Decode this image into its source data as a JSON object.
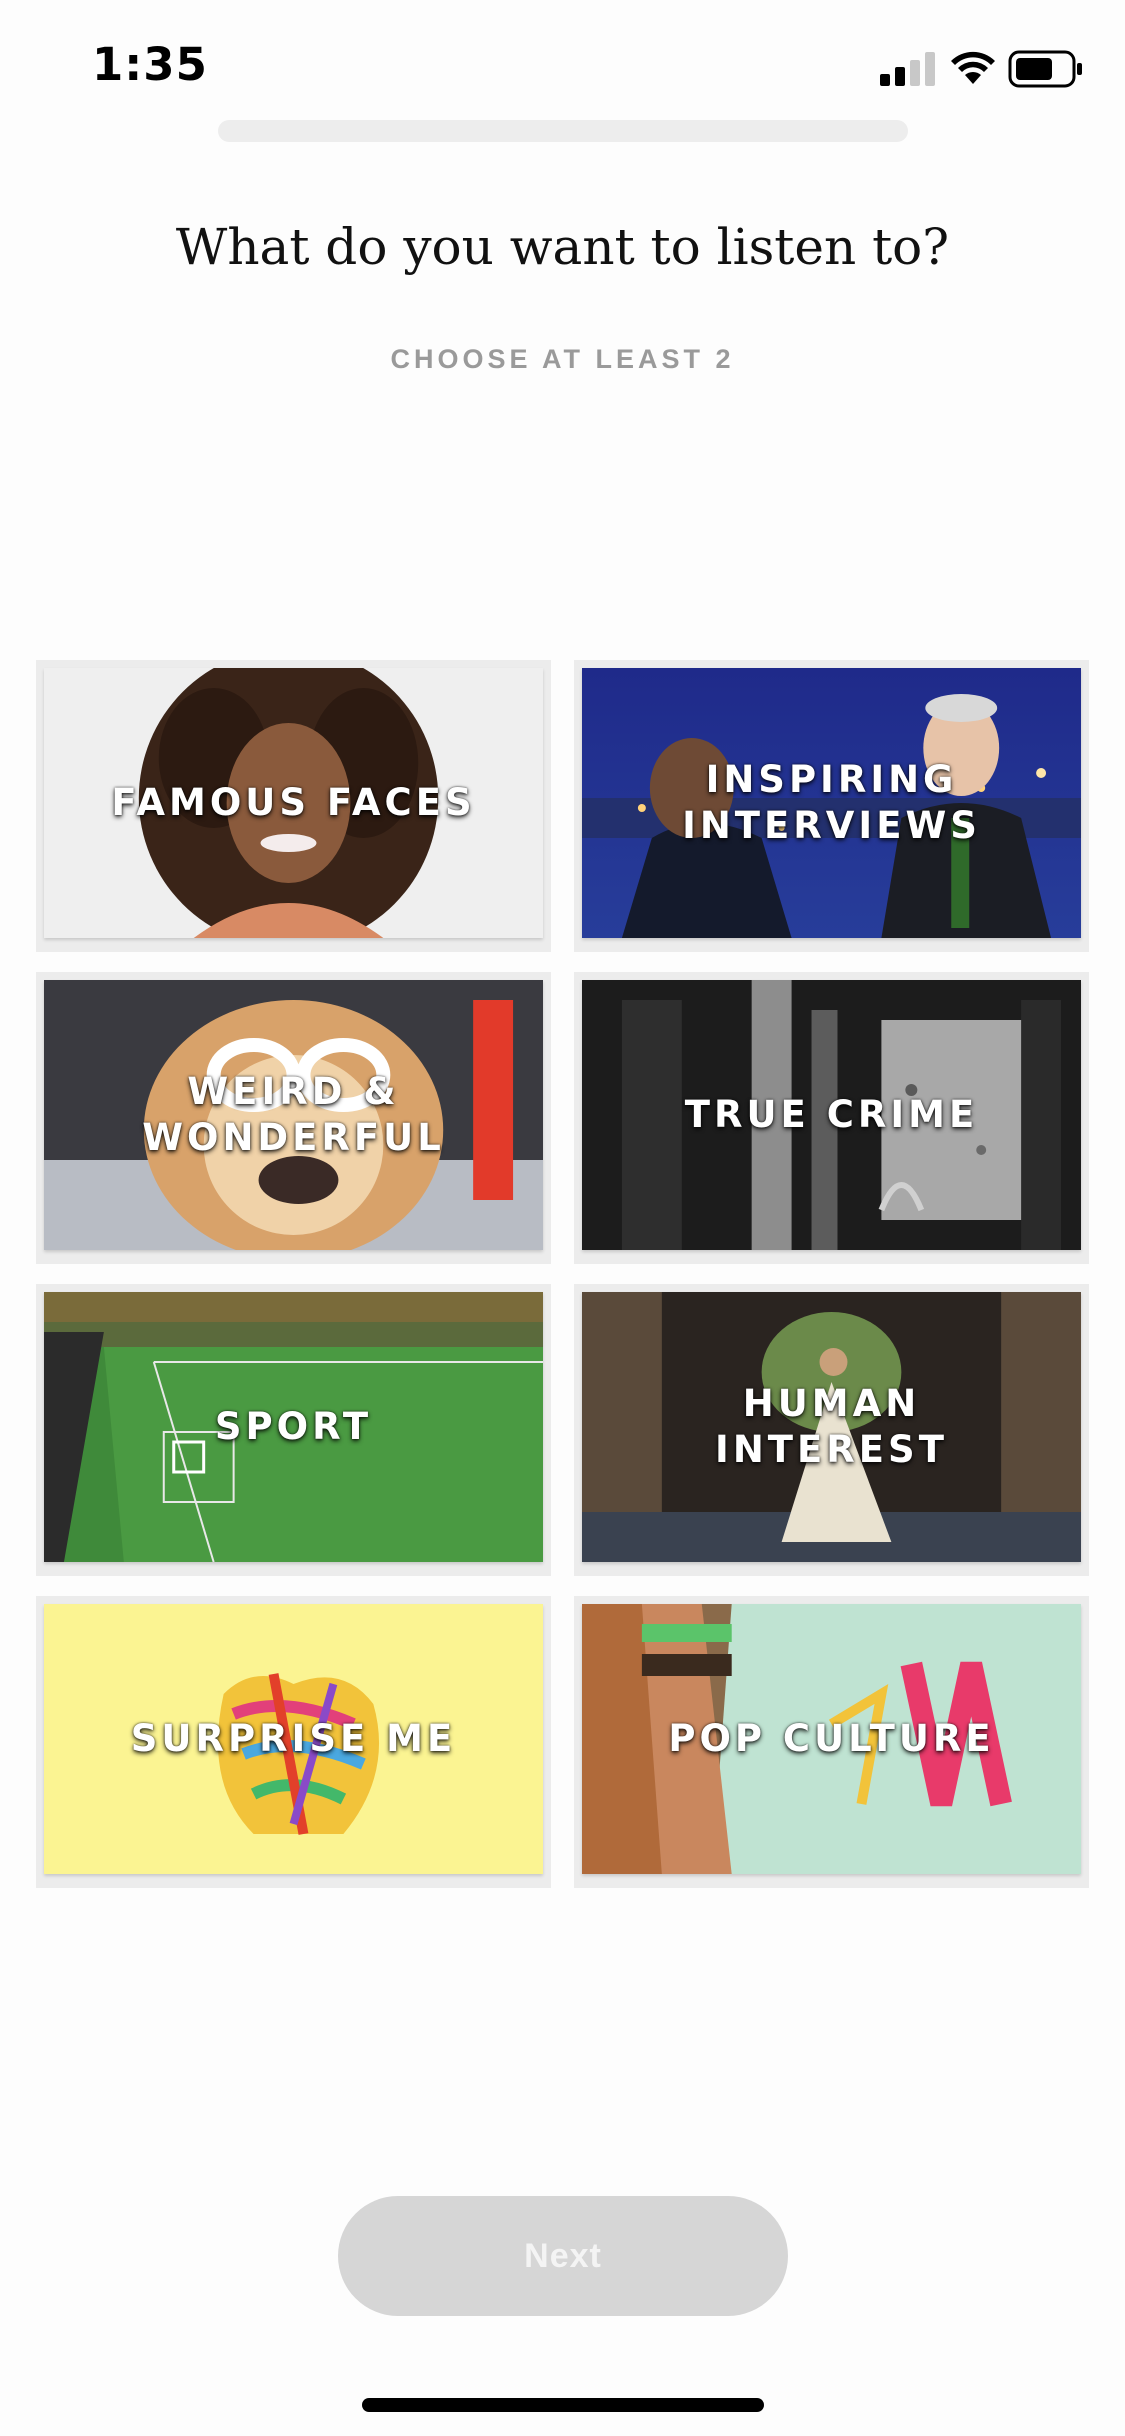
{
  "status_bar": {
    "time": "1:35",
    "icons": [
      "cellular-signal-icon",
      "wifi-icon",
      "battery-icon"
    ]
  },
  "progress": {
    "fraction": 0.0
  },
  "header": {
    "title": "What do you want to listen to?",
    "subtitle": "CHOOSE AT LEAST 2"
  },
  "categories": [
    {
      "label": "FAMOUS FACES"
    },
    {
      "label": "INSPIRING\nINTERVIEWS"
    },
    {
      "label": "WEIRD &\nWONDERFUL"
    },
    {
      "label": "TRUE CRIME"
    },
    {
      "label": "SPORT"
    },
    {
      "label": "HUMAN\nINTEREST"
    },
    {
      "label": "SURPRISE ME"
    },
    {
      "label": "POP CULTURE"
    }
  ],
  "footer": {
    "next_label": "Next"
  },
  "colors": {
    "button_disabled": "#d6d6d6",
    "subtitle": "#9a9a9a",
    "surprise_bg": "#fbf492"
  }
}
